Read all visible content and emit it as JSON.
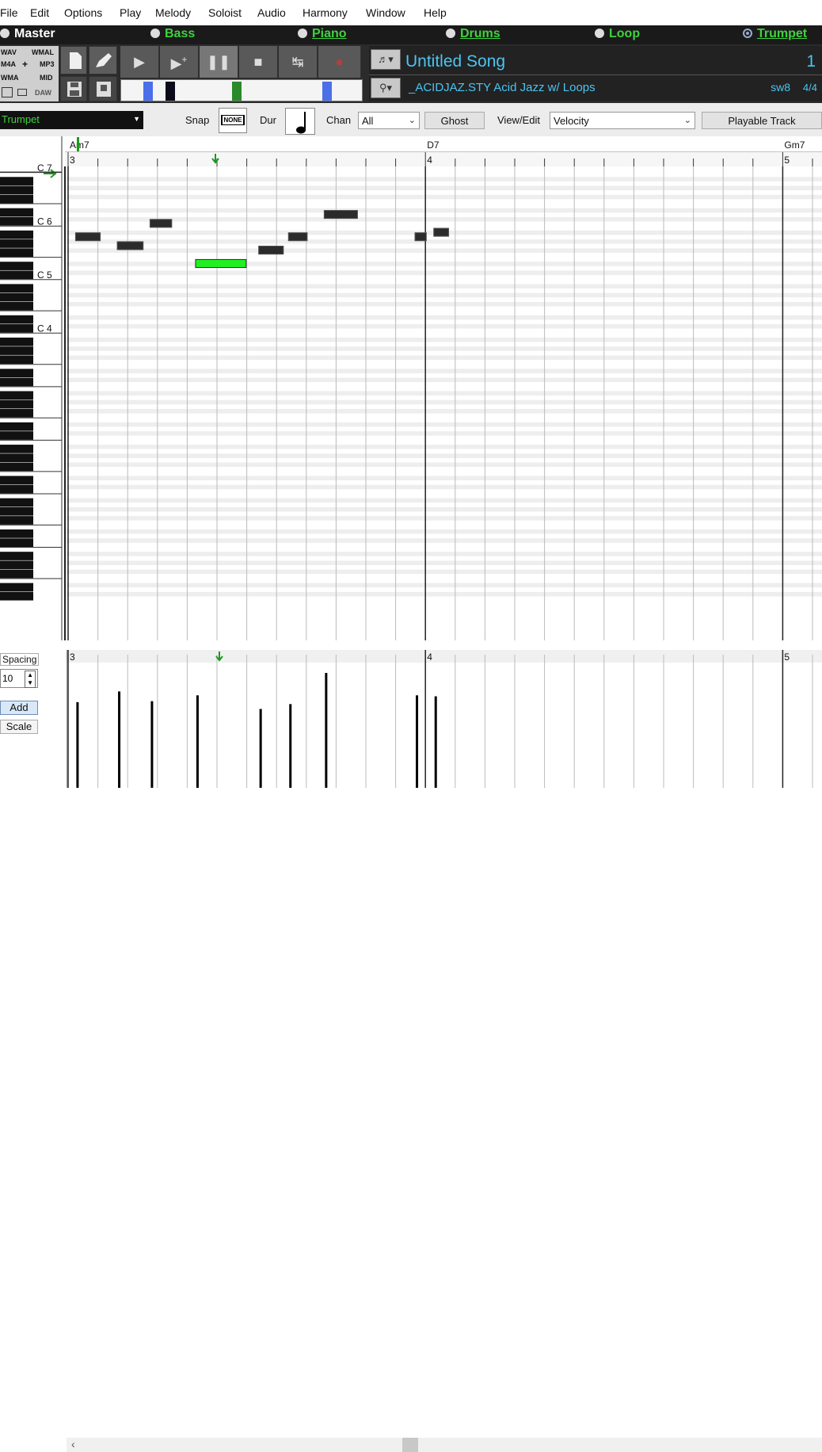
{
  "menu": [
    "File",
    "Edit",
    "Options",
    "Play",
    "Melody",
    "Soloist",
    "Audio",
    "Harmony",
    "Window",
    "Help"
  ],
  "tracks": [
    {
      "label": "Master",
      "state": "master"
    },
    {
      "label": "Bass",
      "state": "plain"
    },
    {
      "label": "Piano",
      "state": "underline"
    },
    {
      "label": "Drums",
      "state": "underline"
    },
    {
      "label": "Loop",
      "state": "plain"
    },
    {
      "label": "Trumpet",
      "state": "selected"
    }
  ],
  "export_formats": {
    "wav": "WAV",
    "wmal": "WMAL",
    "m4a": "M4A",
    "plus": "+",
    "mp3": "MP3",
    "wma": "WMA",
    "mid": "MID",
    "daw": "DAW"
  },
  "song": {
    "title": "Untitled Song",
    "bar": "1",
    "style": "_ACIDJAZ.STY Acid Jazz w/ Loops",
    "swing": "sw8",
    "time_signature": "4/4"
  },
  "controls": {
    "track": "Trumpet",
    "snap_label": "Snap",
    "snap_value": "NONE",
    "dur_label": "Dur",
    "chan_label": "Chan",
    "chan_value": "All",
    "ghost": "Ghost",
    "viewedit_label": "View/Edit",
    "viewedit_value": "Velocity",
    "playable_track": "Playable Track"
  },
  "chords": [
    "Am7",
    "D7",
    "Gm7"
  ],
  "bars": [
    "3",
    "4",
    "5"
  ],
  "octave_labels": [
    "C 7",
    "C 6",
    "C 5",
    "C 4"
  ],
  "notes": [
    {
      "beat": 0.25,
      "len": 0.83,
      "pitch": 81,
      "velocity": 88,
      "selected": false
    },
    {
      "beat": 1.65,
      "len": 0.87,
      "pitch": 79,
      "velocity": 99,
      "selected": false
    },
    {
      "beat": 2.75,
      "len": 0.73,
      "pitch": 84,
      "velocity": 89,
      "selected": false
    },
    {
      "beat": 4.28,
      "len": 1.7,
      "pitch": 75,
      "velocity": 95,
      "selected": true
    },
    {
      "beat": 6.4,
      "len": 0.83,
      "pitch": 78,
      "velocity": 81,
      "selected": false
    },
    {
      "beat": 7.4,
      "len": 0.63,
      "pitch": 81,
      "velocity": 86,
      "selected": false
    },
    {
      "beat": 8.6,
      "len": 1.12,
      "pitch": 86,
      "velocity": 118,
      "selected": false
    },
    {
      "beat": 11.65,
      "len": 0.38,
      "pitch": 81,
      "velocity": 95,
      "selected": false
    },
    {
      "beat": 12.28,
      "len": 0.5,
      "pitch": 82,
      "velocity": 94,
      "selected": false
    }
  ],
  "velocity_pane": {
    "spacing_label": "Spacing",
    "spacing_value": "10",
    "add": "Add",
    "scale": "Scale",
    "ticks": [
      "127",
      "96",
      "64",
      "32",
      "0"
    ]
  },
  "colors": {
    "note": "#2b2b2b",
    "note_selected": "#22ee22",
    "track_active": "#3fd23f",
    "song_text": "#4cc4f0"
  }
}
